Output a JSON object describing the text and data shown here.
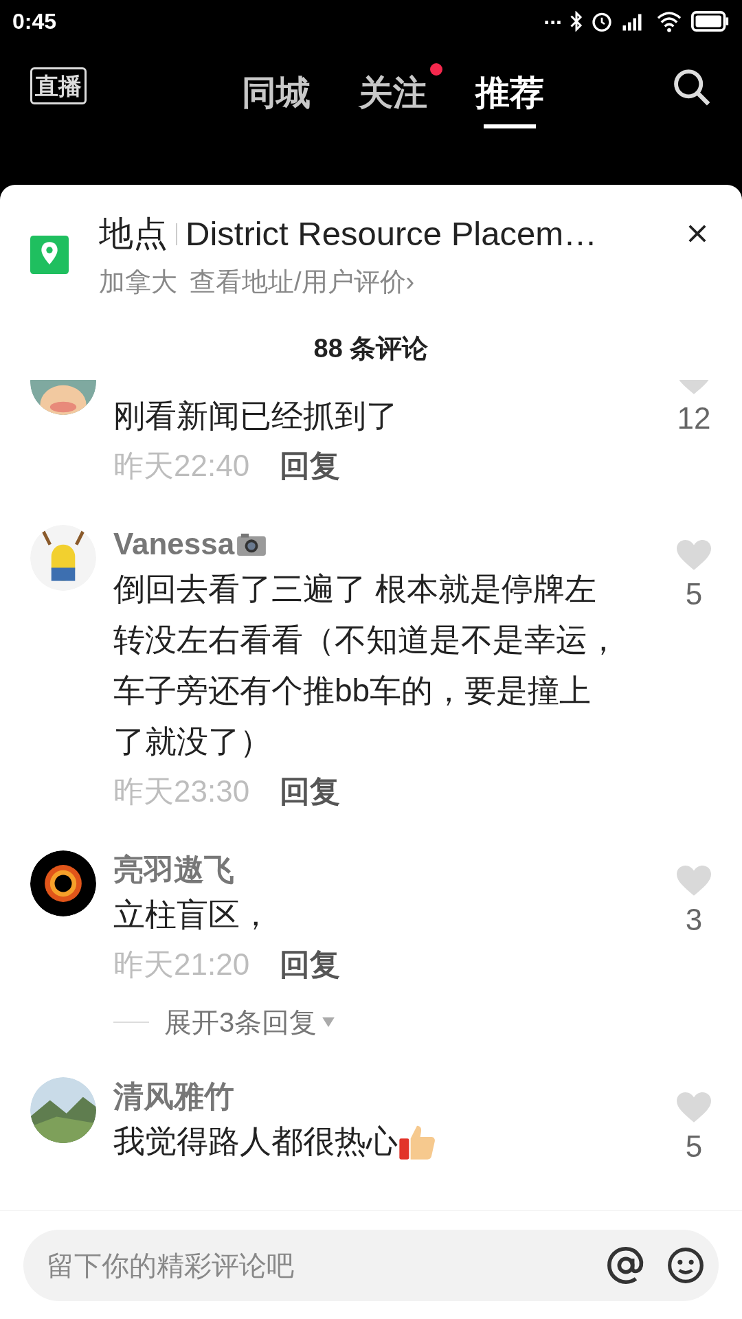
{
  "status_bar": {
    "time": "0:45",
    "more": "..."
  },
  "nav": {
    "live_label": "直播",
    "tabs": [
      {
        "label": "同城",
        "selected": false,
        "dot": false
      },
      {
        "label": "关注",
        "selected": false,
        "dot": true
      },
      {
        "label": "推荐",
        "selected": true,
        "dot": false
      }
    ]
  },
  "location": {
    "label": "地点",
    "name": "District Resource Placem…",
    "country": "加拿大",
    "link": "查看地址/用户评价",
    "chevron": "›"
  },
  "comment_count": "88 条评论",
  "comments": [
    {
      "text": "刚看新闻已经抓到了",
      "time": "昨天22:40",
      "reply": "回复",
      "likes": "12"
    },
    {
      "username": "Vanessa",
      "camera": true,
      "text": "倒回去看了三遍了 根本就是停牌左转没左右看看（不知道是不是幸运，车子旁还有个推bb车的，要是撞上了就没了）",
      "time": "昨天23:30",
      "reply": "回复",
      "likes": "5"
    },
    {
      "username": "亮羽遨飞",
      "text": "立柱盲区，",
      "time": "昨天21:20",
      "reply": "回复",
      "likes": "3",
      "expand": "展开3条回复"
    },
    {
      "username": "清风雅竹",
      "text": "我觉得路人都很热心",
      "thumbs": true,
      "likes": "5"
    }
  ],
  "input": {
    "placeholder": "留下你的精彩评论吧"
  }
}
